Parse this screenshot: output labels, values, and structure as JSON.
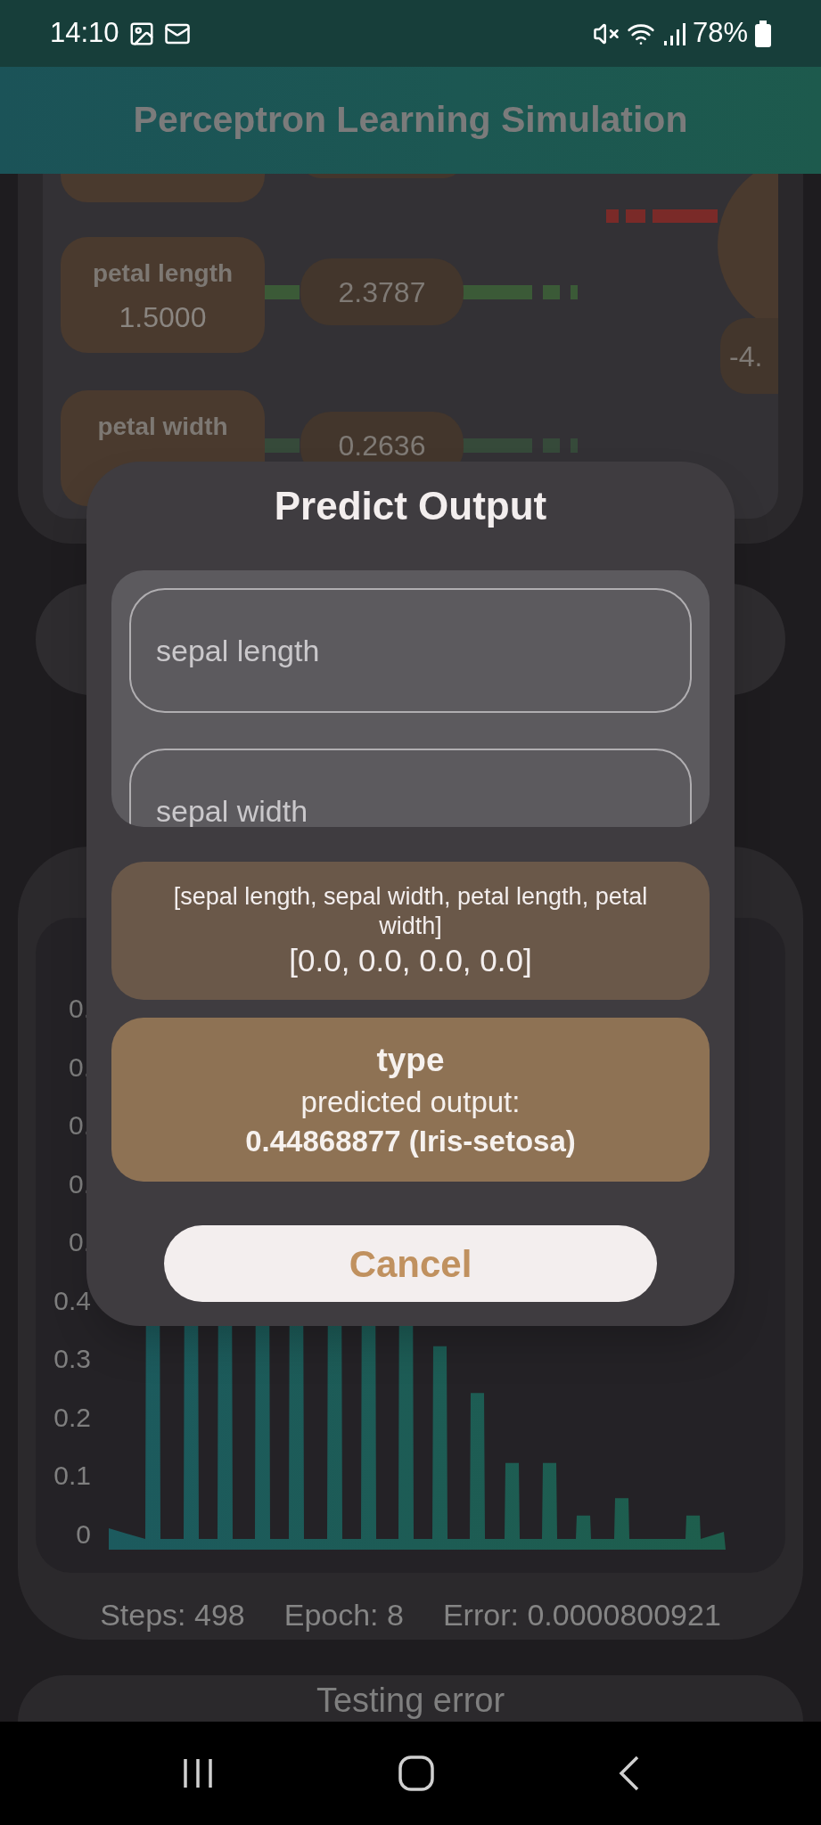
{
  "status_bar": {
    "time": "14:10",
    "battery": "78%"
  },
  "app_bar": {
    "title": "Perceptron Learning Simulation"
  },
  "network": {
    "inputs": [
      {
        "label": "petal length",
        "value": "1.5000",
        "weight": "2.3787"
      },
      {
        "label": "petal width",
        "weight": "0.2636"
      }
    ],
    "output_value": "-4."
  },
  "training": {
    "y_axis_labels": [
      "0.",
      "0.",
      "0.",
      "0.",
      "0.",
      "0.4",
      "0.3",
      "0.2",
      "0.1",
      "0"
    ],
    "steps": "Steps: 498",
    "epoch": "Epoch: 8",
    "error": "Error: 0.0000800921"
  },
  "testing": {
    "title": "Testing error"
  },
  "dialog": {
    "title": "Predict Output",
    "fields": [
      {
        "placeholder": "sepal length"
      },
      {
        "placeholder": "sepal width"
      }
    ],
    "feature_names": "[sepal length, sepal width, petal length, petal width]",
    "input_vector": "[0.0, 0.0, 0.0, 0.0]",
    "result_title": "type",
    "result_label": "predicted output:",
    "result_value": "0.44868877 (Iris-setosa)",
    "cancel": "Cancel"
  }
}
